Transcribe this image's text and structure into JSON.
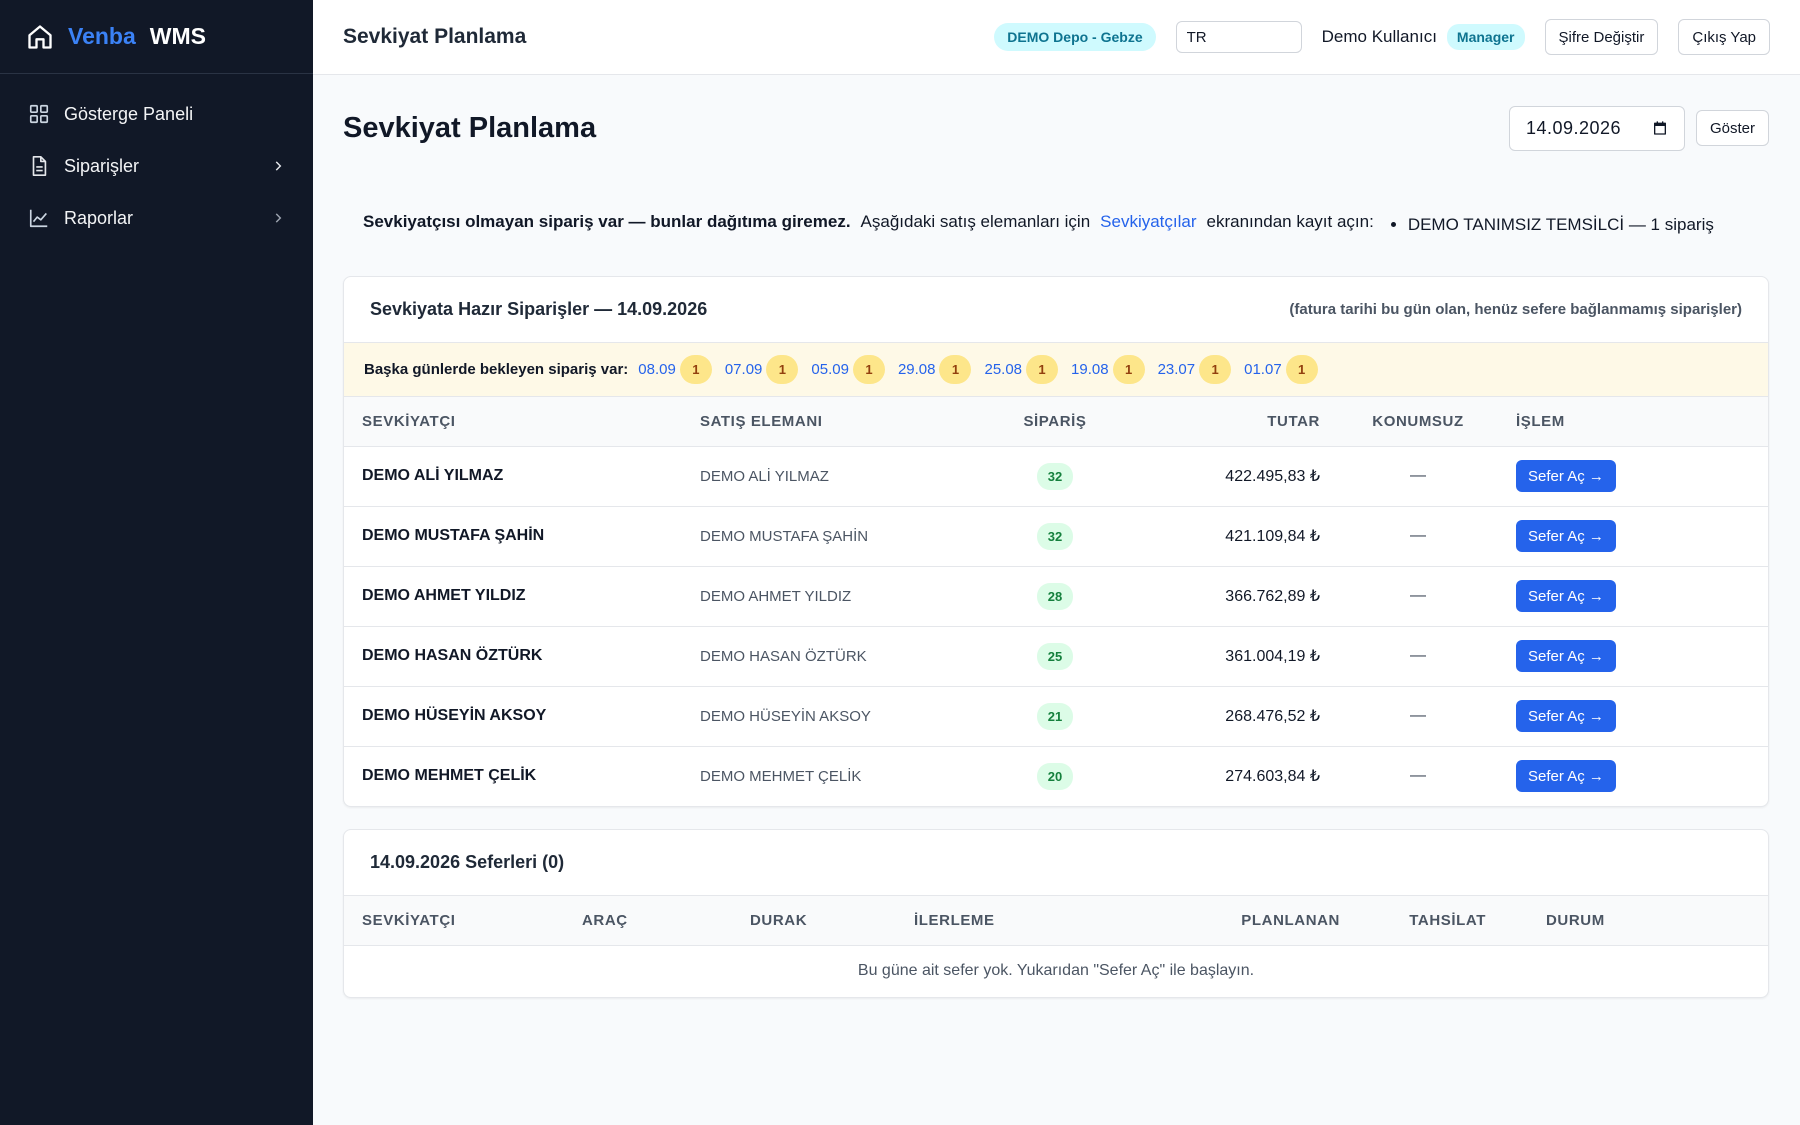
{
  "brand": {
    "part1": "Venba",
    "part2": "WMS"
  },
  "sidebar": {
    "items": [
      {
        "label": "Gösterge Paneli",
        "icon": "grid-icon"
      },
      {
        "label": "Siparişler",
        "icon": "document-icon"
      },
      {
        "label": "Raporlar",
        "icon": "chart-line-icon"
      }
    ]
  },
  "header": {
    "title": "Sevkiyat Planlama",
    "depot": "DEMO Depo - Gebze",
    "lang_value": "TR",
    "user": "Demo Kullanıcı",
    "role": "Manager",
    "change_password": "Şifre Değiştir",
    "logout": "Çıkış Yap"
  },
  "page": {
    "title": "Sevkiyat Planlama",
    "date": "14.09.2026",
    "show_button": "Göster"
  },
  "warning": {
    "bold": "Sevkiyatçısı olmayan sipariş var — bunlar dağıtıma giremez.",
    "text1": "Aşağıdaki satış elemanları için",
    "link": "Sevkiyatçılar",
    "text2": "ekranından kayıt açın:",
    "items": [
      "DEMO TANIMSIZ TEMSİLCİ — 1 sipariş"
    ]
  },
  "ready": {
    "title": "Sevkiyata Hazır Siparişler — 14.09.2026",
    "note": "(fatura tarihi bu gün olan, henüz sefere bağlanmamış siparişler)",
    "pending_label": "Başka günlerde bekleyen sipariş var:",
    "pending": [
      {
        "date": "08.09",
        "count": "1"
      },
      {
        "date": "07.09",
        "count": "1"
      },
      {
        "date": "05.09",
        "count": "1"
      },
      {
        "date": "29.08",
        "count": "1"
      },
      {
        "date": "25.08",
        "count": "1"
      },
      {
        "date": "19.08",
        "count": "1"
      },
      {
        "date": "23.07",
        "count": "1"
      },
      {
        "date": "01.07",
        "count": "1"
      }
    ],
    "columns": [
      "SEVKİYATÇI",
      "SATIŞ ELEMANI",
      "SİPARİŞ",
      "TUTAR",
      "KONUMSUZ",
      "İŞLEM"
    ],
    "rows": [
      {
        "shipper": "DEMO ALİ YILMAZ",
        "sales": "DEMO ALİ YILMAZ",
        "orders": "32",
        "amount": "422.495,83 ₺",
        "nolocation": "—",
        "action": "Sefer Aç →"
      },
      {
        "shipper": "DEMO MUSTAFA ŞAHİN",
        "sales": "DEMO MUSTAFA ŞAHİN",
        "orders": "32",
        "amount": "421.109,84 ₺",
        "nolocation": "—",
        "action": "Sefer Aç →"
      },
      {
        "shipper": "DEMO AHMET YILDIZ",
        "sales": "DEMO AHMET YILDIZ",
        "orders": "28",
        "amount": "366.762,89 ₺",
        "nolocation": "—",
        "action": "Sefer Aç →"
      },
      {
        "shipper": "DEMO HASAN ÖZTÜRK",
        "sales": "DEMO HASAN ÖZTÜRK",
        "orders": "25",
        "amount": "361.004,19 ₺",
        "nolocation": "—",
        "action": "Sefer Aç →"
      },
      {
        "shipper": "DEMO HÜSEYİN AKSOY",
        "sales": "DEMO HÜSEYİN AKSOY",
        "orders": "21",
        "amount": "268.476,52 ₺",
        "nolocation": "—",
        "action": "Sefer Aç →"
      },
      {
        "shipper": "DEMO MEHMET ÇELİK",
        "sales": "DEMO MEHMET ÇELİK",
        "orders": "20",
        "amount": "274.603,84 ₺",
        "nolocation": "—",
        "action": "Sefer Aç →"
      }
    ]
  },
  "trips": {
    "title": "14.09.2026 Seferleri (0)",
    "columns": [
      "SEVKİYATÇI",
      "ARAÇ",
      "DURAK",
      "İLERLEME",
      "PLANLANAN",
      "TAHSİLAT",
      "DURUM"
    ],
    "empty": "Bu güne ait sefer yok. Yukarıdan \"Sefer Aç\" ile başlayın."
  },
  "colors": {
    "sidebar_bg": "#111827",
    "accent": "#2563eb",
    "brand_blue": "#3b82f6",
    "badge_cyan": "#cffafe",
    "pending_bg": "#fef9e7"
  }
}
